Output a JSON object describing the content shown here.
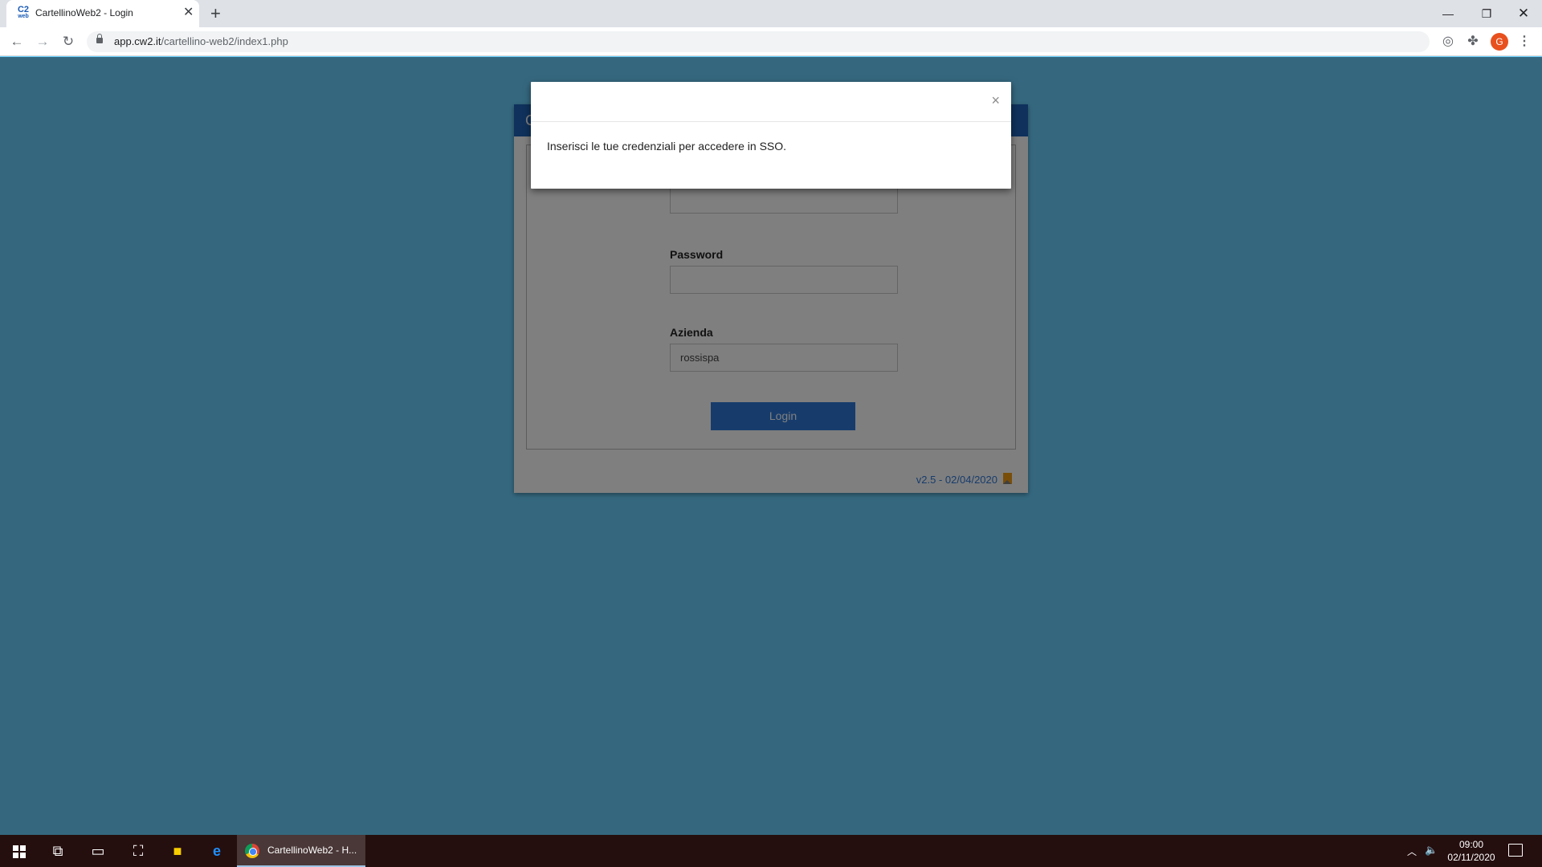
{
  "browser": {
    "tab_title": "CartellinoWeb2 - Login",
    "favicon_text": "C2",
    "favicon_sub": "web",
    "url_host": "app.cw2.it",
    "url_path": "/cartellino-web2/index1.php",
    "avatar_letter": "G",
    "icons": [
      "back-arrow-icon",
      "forward-arrow-icon",
      "reload-icon",
      "lock-icon",
      "star-icon",
      "extension-icon",
      "puzzle-icon",
      "menu-icon"
    ]
  },
  "login": {
    "header_initial": "C",
    "fields": [
      {
        "label": "Password",
        "value": ""
      },
      {
        "label": "Azienda",
        "value": "rossispa"
      }
    ],
    "button_label": "Login",
    "version": "v2.5 - 02/04/2020"
  },
  "modal": {
    "close_glyph": "×",
    "message": "Inserisci le tue credenziali per accedere in SSO."
  },
  "taskbar": {
    "app_label": "CartellinoWeb2 - H...",
    "time": "09:00",
    "date": "02/11/2020"
  },
  "colors": {
    "page_bg": "#356985",
    "header_blue": "#1e62b9",
    "button_blue": "#2f79d9",
    "taskbar": "#250e0e"
  }
}
